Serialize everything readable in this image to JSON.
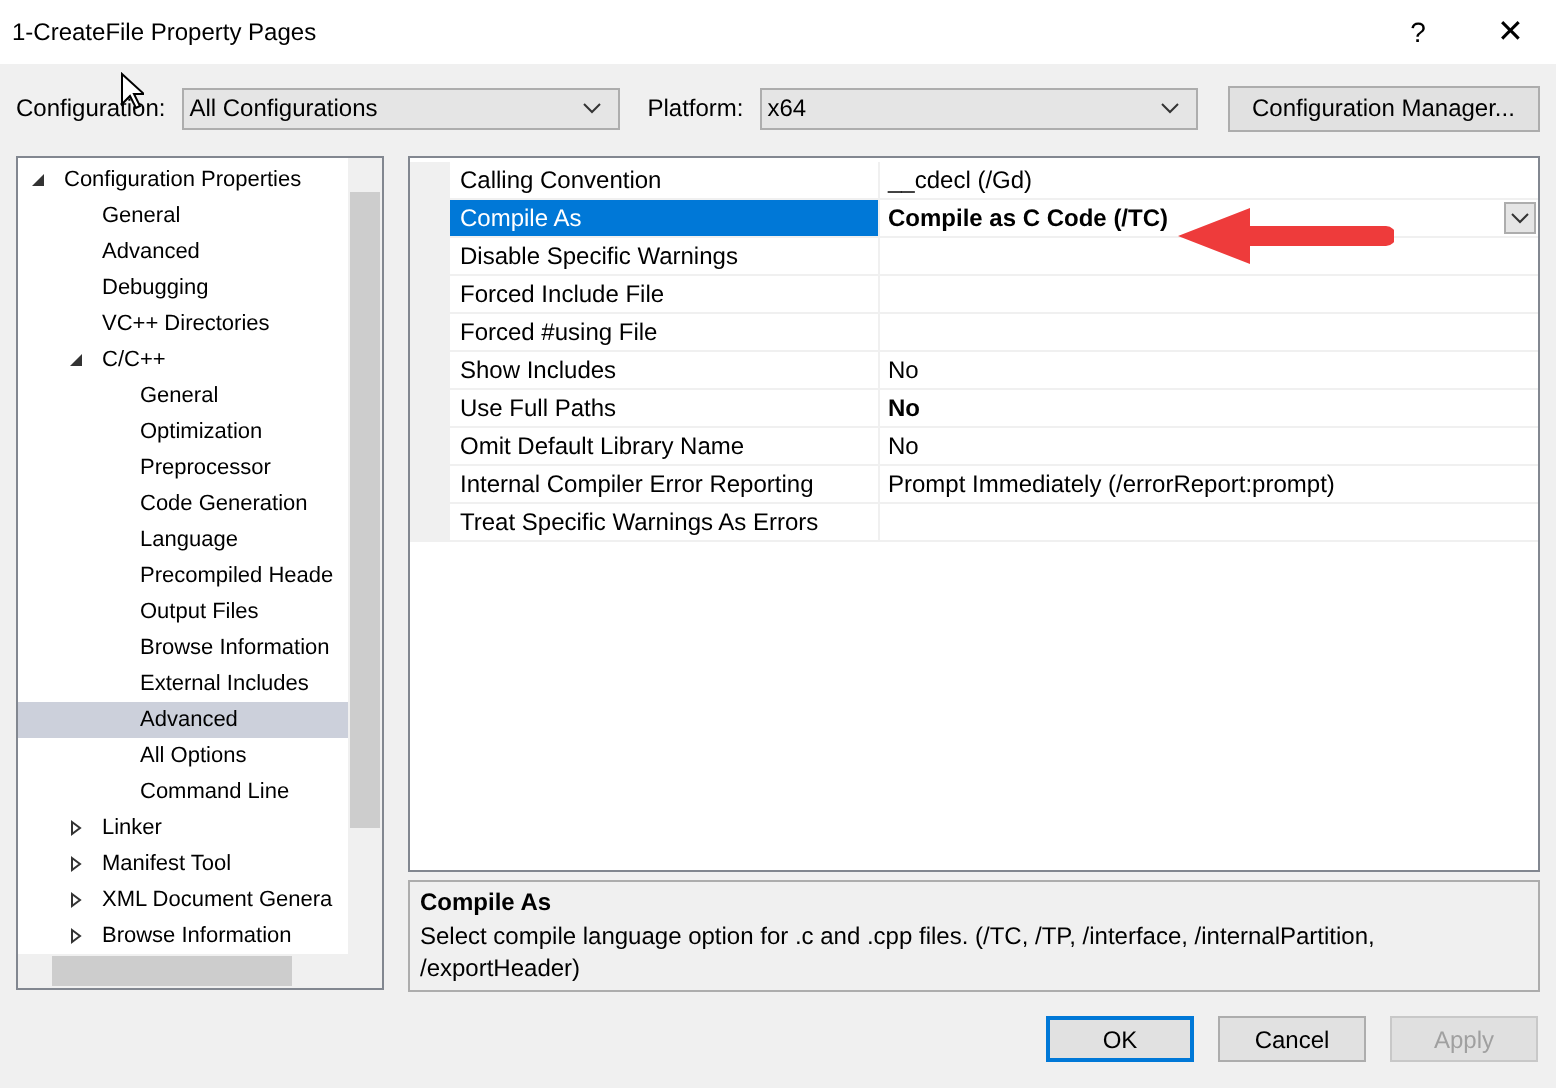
{
  "window": {
    "title": "1-CreateFile Property Pages",
    "help": "?",
    "close": "✕"
  },
  "toolbar": {
    "configuration_label": "Configuration:",
    "configuration": "All Configurations",
    "platform_label": "Platform:",
    "platform": "x64",
    "manager_button": "Configuration Manager..."
  },
  "tree": [
    {
      "label": "Configuration Properties",
      "expanded": true,
      "selected": false,
      "children": [
        {
          "label": "General",
          "selected": false
        },
        {
          "label": "Advanced",
          "selected": false
        },
        {
          "label": "Debugging",
          "selected": false
        },
        {
          "label": "VC++ Directories",
          "selected": false
        },
        {
          "label": "C/C++",
          "expanded": true,
          "selected": false,
          "children": [
            {
              "label": "General",
              "selected": false
            },
            {
              "label": "Optimization",
              "selected": false
            },
            {
              "label": "Preprocessor",
              "selected": false
            },
            {
              "label": "Code Generation",
              "selected": false
            },
            {
              "label": "Language",
              "selected": false
            },
            {
              "label": "Precompiled Heade",
              "selected": false
            },
            {
              "label": "Output Files",
              "selected": false
            },
            {
              "label": "Browse Information",
              "selected": false
            },
            {
              "label": "External Includes",
              "selected": false
            },
            {
              "label": "Advanced",
              "selected": true
            },
            {
              "label": "All Options",
              "selected": false
            },
            {
              "label": "Command Line",
              "selected": false
            }
          ]
        },
        {
          "label": "Linker",
          "expanded": false,
          "selected": false
        },
        {
          "label": "Manifest Tool",
          "expanded": false,
          "selected": false
        },
        {
          "label": "XML Document Genera",
          "expanded": false,
          "selected": false
        },
        {
          "label": "Browse Information",
          "expanded": false,
          "selected": false
        }
      ]
    }
  ],
  "properties": [
    {
      "name": "Calling Convention",
      "value": "__cdecl (/Gd)",
      "bold": false,
      "selected": false
    },
    {
      "name": "Compile As",
      "value": "Compile as C Code (/TC)",
      "bold": true,
      "selected": true
    },
    {
      "name": "Disable Specific Warnings",
      "selected": false
    },
    {
      "name": "Forced Include File",
      "selected": false
    },
    {
      "name": "Forced #using File",
      "selected": false
    },
    {
      "name": "Show Includes",
      "value": "No",
      "bold": false,
      "selected": false
    },
    {
      "name": "Use Full Paths",
      "value": "No",
      "bold": true,
      "selected": false
    },
    {
      "name": "Omit Default Library Name",
      "value": "No",
      "bold": false,
      "selected": false
    },
    {
      "name": "Internal Compiler Error Reporting",
      "value": "Prompt Immediately (/errorReport:prompt)",
      "bold": false,
      "selected": false
    },
    {
      "name": "Treat Specific Warnings As Errors",
      "selected": false
    }
  ],
  "description": {
    "title": "Compile As",
    "text": "Select compile language option for .c and .cpp files.     (/TC, /TP, /interface, /internalPartition, /exportHeader)"
  },
  "buttons": [
    {
      "label": "OK",
      "kind": "default",
      "disabled": false
    },
    {
      "label": "Cancel",
      "kind": "normal",
      "disabled": false
    },
    {
      "label": "Apply",
      "kind": "normal",
      "disabled": true
    }
  ]
}
